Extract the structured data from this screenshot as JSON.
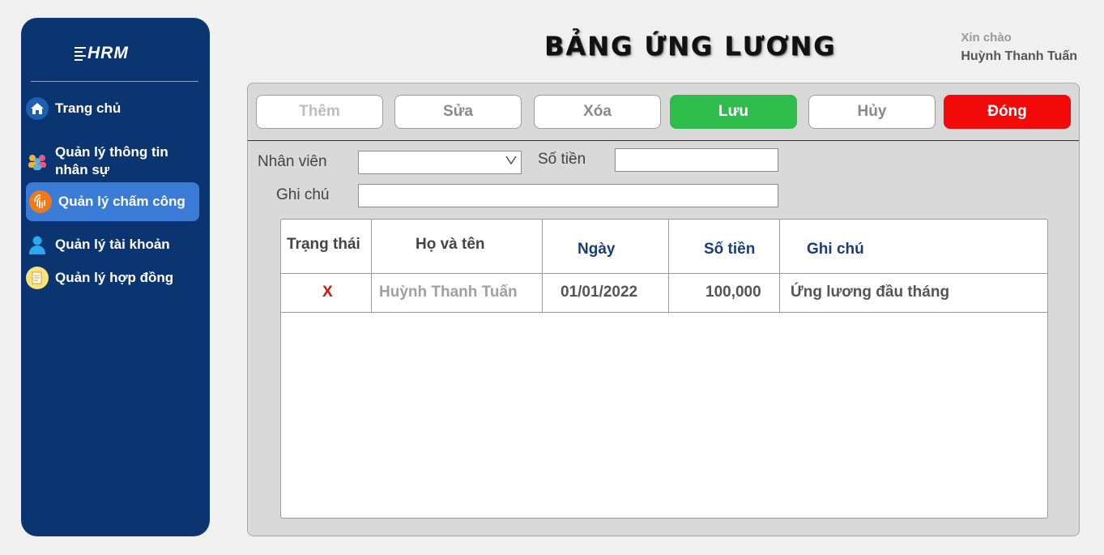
{
  "sidebar": {
    "logo": "HRM",
    "items": [
      {
        "label": "Trang chủ",
        "icon": "home-icon",
        "active": false
      },
      {
        "label": "Quản lý thông tin nhân sự",
        "icon": "people-icon",
        "active": false
      },
      {
        "label": "Quản lý chấm công",
        "icon": "fingerprint-icon",
        "active": true
      },
      {
        "label": "Quản lý tài khoản",
        "icon": "user-icon",
        "active": false
      },
      {
        "label": "Quản lý hợp đồng",
        "icon": "contract-icon",
        "active": false
      }
    ]
  },
  "header": {
    "title": "BẢNG ỨNG LƯƠNG",
    "greeting": "Xin chào",
    "user_name": "Huỳnh Thanh Tuấn"
  },
  "toolbar": {
    "add": "Thêm",
    "edit": "Sửa",
    "delete": "Xóa",
    "save": "Lưu",
    "cancel": "Hủy",
    "close": "Đóng"
  },
  "form": {
    "employee_label": "Nhân viên",
    "employee_value": "",
    "amount_label": "Số tiền",
    "amount_value": "",
    "note_label": "Ghi chú",
    "note_value": ""
  },
  "table": {
    "columns": [
      "Trạng thái",
      "Họ và tên",
      "Ngày",
      "Số tiền",
      "Ghi chú"
    ],
    "rows": [
      {
        "status": "X",
        "name": "Huỳnh Thanh Tuấn",
        "date": "01/01/2022",
        "amount": "100,000",
        "note": "Ứng lương đầu tháng"
      }
    ]
  },
  "colors": {
    "sidebar_bg": "#0b3570",
    "active_item": "#3a7bd5",
    "save_button": "#2ebd4a",
    "close_button": "#f20a0a",
    "status_x": "#e01010",
    "header_blue": "#1a3d78"
  }
}
